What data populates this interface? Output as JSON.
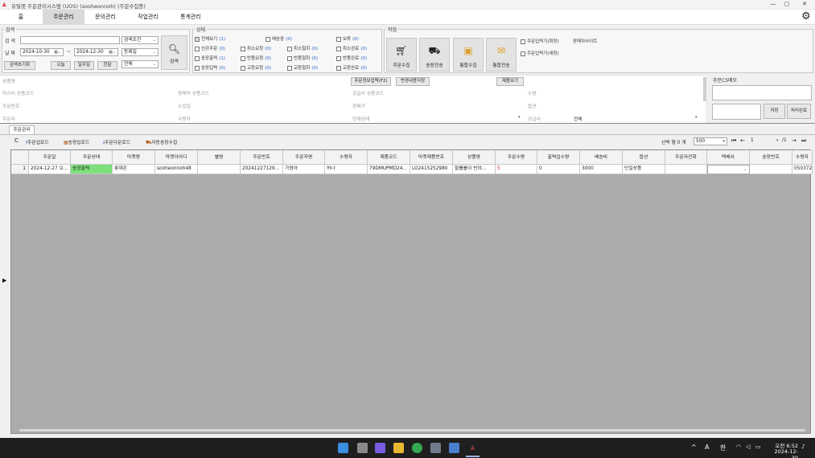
{
  "window": {
    "title": "유틸렛 주문관리시스템 (UOS) (sooheonnoh) (주문수집중)",
    "logo": "⩓",
    "minimize": "—",
    "maximize": "▢",
    "close": "✕"
  },
  "menu": {
    "items": [
      "홈",
      "주문관리",
      "문의관리",
      "작업관리",
      "통계관리"
    ],
    "active_index": 1
  },
  "search": {
    "group_label": "검색",
    "search_label": "검 색",
    "search_value": "",
    "condition_select": "검색조건",
    "date_label": "날 짜",
    "date_from": "2024-10-30",
    "tilde": "~",
    "date_to": "2024-12-30",
    "date_type_select": "등록일",
    "scope_select": "전체",
    "reset_button": "검색초기화",
    "today_button": "오늘",
    "week_button": "일주일",
    "month_button": "한달",
    "search_button": "검색",
    "search_icon": "search-icon"
  },
  "status": {
    "group_label": "상태",
    "items": [
      {
        "label": "전체보기",
        "count": "(1)",
        "disabled": true
      },
      {
        "label": "배송중",
        "count": "(0)"
      },
      {
        "label": "보류",
        "count": "(0)"
      },
      {
        "label": "신규주문",
        "count": "(0)"
      },
      {
        "label": "취소요청",
        "count": "(0)"
      },
      {
        "label": "취소철회",
        "count": "(0)"
      },
      {
        "label": "취소완료",
        "count": "(0)"
      },
      {
        "label": "송장출력",
        "count": "(1)"
      },
      {
        "label": "반품요청",
        "count": "(0)"
      },
      {
        "label": "반품철회",
        "count": "(0)"
      },
      {
        "label": "반품완료",
        "count": "(0)"
      },
      {
        "label": "송장입력",
        "count": "(0)"
      },
      {
        "label": "교환요청",
        "count": "(0)"
      },
      {
        "label": "교환철회",
        "count": "(0)"
      },
      {
        "label": "교환완료",
        "count": "(0)"
      }
    ]
  },
  "work": {
    "group_label": "작업",
    "buttons": [
      "주문수집",
      "송장전송",
      "통합수집",
      "통합전송"
    ],
    "check_extended": "주문입력기(확장)",
    "seller_site": "판매자사이트",
    "check_new": "주문입력기(새창)"
  },
  "detail": {
    "fields_col1": [
      "상품명",
      "마스터 상품코드",
      "주문번호",
      "주문자"
    ],
    "fields_col2": [
      "판매처 상품코드",
      "수집일",
      "수령자"
    ],
    "fields_col3": [
      "공급사 상품코드",
      "판매가",
      "현재상태"
    ],
    "fields_col4": [
      "수량",
      "옵션",
      "공급사"
    ],
    "supplier_value": "전체",
    "btn_order_info": "주문정보입력(F2)",
    "btn_save_changes": "변경내용저장",
    "btn_product_view": "제품보기",
    "cs_memo_label": "주문CS메모",
    "save_button": "저장",
    "process_done_button": "처리완료"
  },
  "tab": {
    "label": "주문관리"
  },
  "toolbar": {
    "refresh": "C",
    "order_upload": "주문업로드",
    "invoice_upload": "송장업로드",
    "order_download": "주문다운로드",
    "auto_invoice": "자동송장수집",
    "selected": "선택 행 0 개",
    "page_size": "500",
    "page_current": "1",
    "page_total": "/1"
  },
  "grid": {
    "headers": [
      "",
      "주문일",
      "주문상태",
      "마켓명",
      "마켓아이디",
      "별명",
      "주문번호",
      "주문자명",
      "수령자",
      "제품코드",
      "마켓제품번호",
      "상품명",
      "주문수량",
      "출력입수량",
      "배송비",
      "옵션",
      "주문자전화",
      "택배사",
      "송장번호",
      "수령자"
    ],
    "rows": [
      [
        "1",
        "2024-12-27 오...",
        "송장출력",
        "롯데온",
        "sooheonnoh48",
        "",
        "20241227129...",
        "가원아",
        "허나",
        "79DMUPMD24...",
        "LO2415252980",
        "할롤롤이 반려...",
        "5",
        "0",
        "3000",
        "단일상품",
        "",
        "",
        "",
        "050372"
      ]
    ]
  },
  "left_arrow": "▶",
  "taskbar": {
    "time": "오전 6:52",
    "date": "2024-12-30",
    "ime_a": "A",
    "ime_han": "한",
    "chevron": "^"
  },
  "colors": {
    "status_highlight": "#7de07a",
    "count_blue": "#2a63c7",
    "qty_red": "#d02020",
    "grid_empty": "#ababab"
  }
}
